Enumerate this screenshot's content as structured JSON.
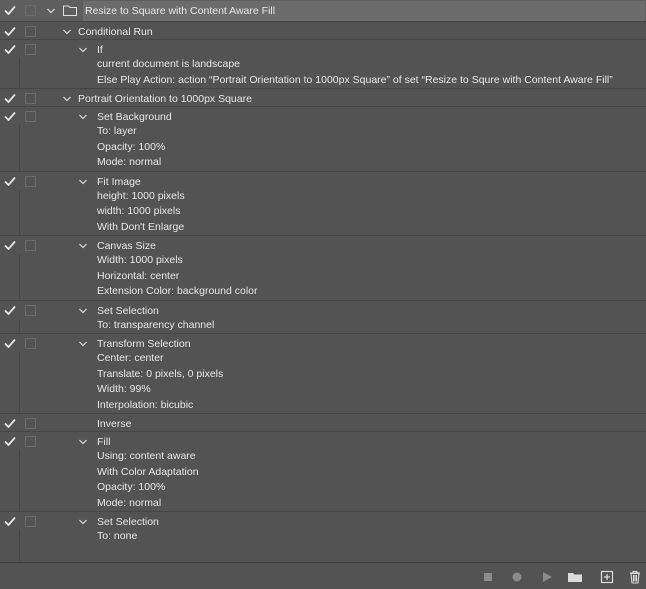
{
  "action_set": {
    "title": "Resize to Square with Content Aware Fill"
  },
  "actions": [
    {
      "name": "Conditional Run",
      "steps": [
        {
          "label": "If",
          "details": [
            "current document is landscape",
            "Else Play Action: action “Portrait Orientation to 1000px Square” of set “Resize to Squre with Content Aware Fill”"
          ]
        }
      ]
    },
    {
      "name": "Portrait Orientation to 1000px Square",
      "steps": [
        {
          "label": "Set Background",
          "details": [
            "To: layer",
            "Opacity: 100%",
            "Mode: normal"
          ]
        },
        {
          "label": "Fit Image",
          "details": [
            "height: 1000 pixels",
            "width: 1000 pixels",
            "With Don't Enlarge"
          ]
        },
        {
          "label": "Canvas Size",
          "details": [
            "Width: 1000 pixels",
            "Horizontal: center",
            "Extension Color: background color"
          ]
        },
        {
          "label": "Set Selection",
          "details": [
            "To: transparency channel"
          ]
        },
        {
          "label": "Transform Selection",
          "details": [
            "Center: center",
            "Translate: 0 pixels, 0 pixels",
            "Width: 99%",
            "Interpolation: bicubic"
          ]
        },
        {
          "label": "Inverse",
          "details": []
        },
        {
          "label": "Fill",
          "details": [
            "Using: content aware",
            "With Color Adaptation",
            "Opacity: 100%",
            "Mode: normal"
          ]
        },
        {
          "label": "Set Selection",
          "details": [
            "To: none"
          ]
        }
      ]
    }
  ],
  "footer": {
    "buttons": [
      "stop-playing",
      "begin-recording",
      "play-selection",
      "create-new-set",
      "create-new-action",
      "delete"
    ]
  },
  "colors": {
    "panel_bg": "#535353",
    "text": "#e8e8e8",
    "top_highlight": "#6c6c6c"
  }
}
